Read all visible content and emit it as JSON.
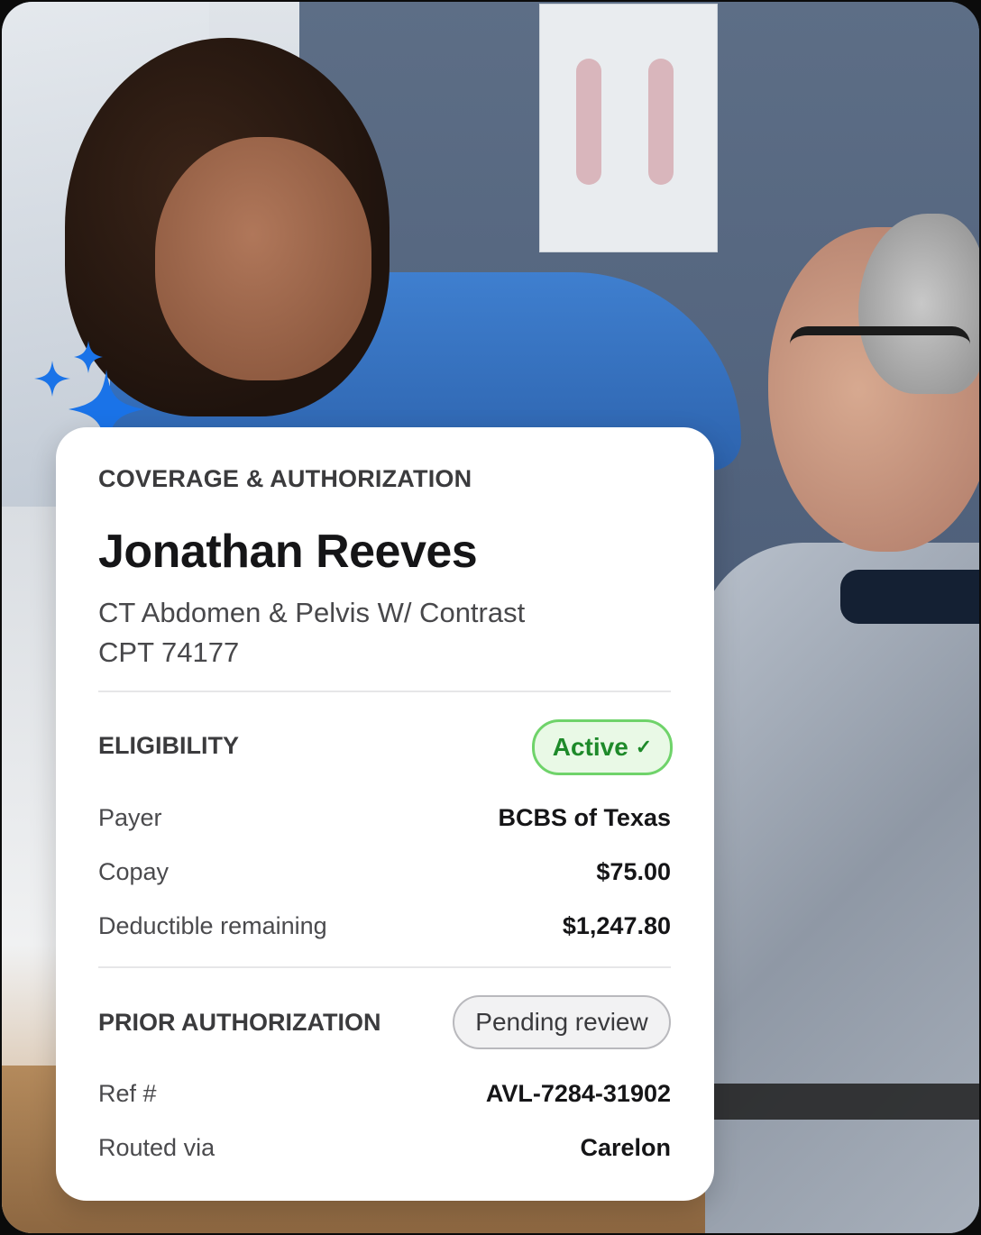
{
  "card": {
    "eyebrow": "COVERAGE & AUTHORIZATION",
    "patient_name": "Jonathan Reeves",
    "procedure": "CT Abdomen & Pelvis W/ Contrast",
    "cpt": "CPT 74177"
  },
  "eligibility": {
    "heading": "ELIGIBILITY",
    "status": "Active",
    "status_icon": "check-icon",
    "rows": [
      {
        "label": "Payer",
        "value": "BCBS of Texas"
      },
      {
        "label": "Copay",
        "value": "$75.00"
      },
      {
        "label": "Deductible remaining",
        "value": "$1,247.80"
      }
    ]
  },
  "prior_authorization": {
    "heading": "PRIOR AUTHORIZATION",
    "status": "Pending review",
    "rows": [
      {
        "label": "Ref #",
        "value": "AVL-7284-31902"
      },
      {
        "label": "Routed via",
        "value": "Carelon"
      }
    ]
  },
  "colors": {
    "accent_blue": "#1a73e8",
    "active_green": "#1e8a2a",
    "active_border": "#6fd36a",
    "active_bg": "#e9f9e6"
  },
  "decor": {
    "sparkle_icon": "sparkle-icon",
    "background": "photo-nurse-with-patient"
  }
}
